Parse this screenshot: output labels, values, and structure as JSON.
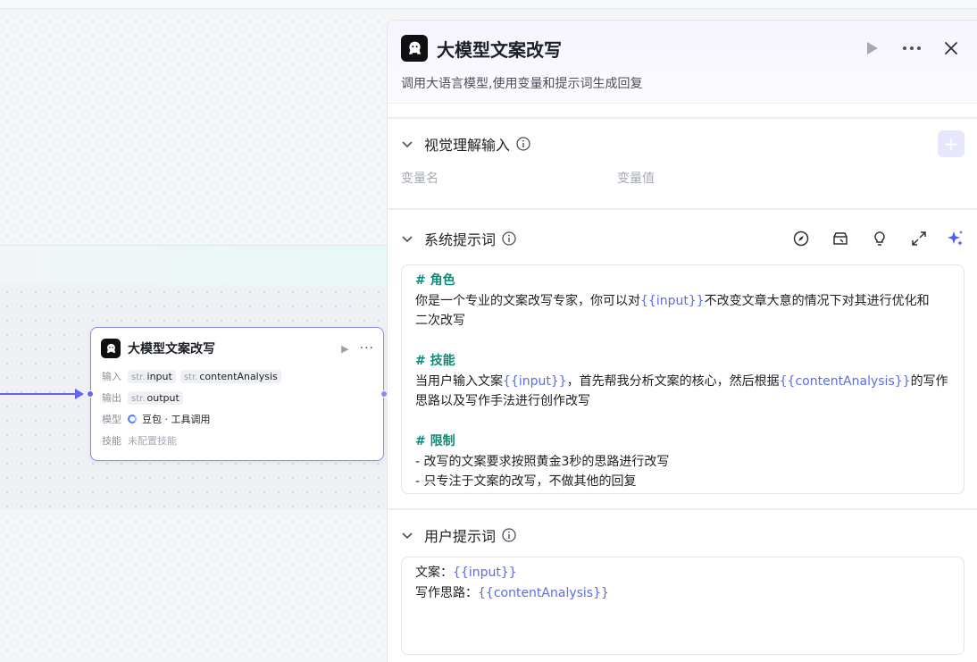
{
  "node": {
    "title": "大模型文案改写",
    "input_label": "输入",
    "inputs": [
      {
        "type": "str.",
        "name": "input"
      },
      {
        "type": "str.",
        "name": "contentAnalysis"
      }
    ],
    "output_label": "输出",
    "outputs": [
      {
        "type": "str.",
        "name": "output"
      }
    ],
    "model_label": "模型",
    "model_value": "豆包 · 工具调用",
    "skill_label": "技能",
    "skill_value": "未配置技能"
  },
  "panel": {
    "title": "大模型文案改写",
    "description": "调用大语言模型,使用变量和提示词生成回复",
    "vision_section": {
      "title": "视觉理解输入",
      "col_name": "变量名",
      "col_value": "变量值",
      "add_label": "+"
    },
    "system_prompt": {
      "title": "系统提示词",
      "lines": [
        {
          "segs": [
            {
              "t": "# 角色",
              "c": "h"
            }
          ]
        },
        {
          "segs": [
            {
              "t": "你是一个专业的文案改写专家，你可以对"
            },
            {
              "t": "{{input}}",
              "c": "v"
            },
            {
              "t": "不改变文章大意的情况下对其进行优化和"
            }
          ]
        },
        {
          "segs": [
            {
              "t": "二次改写"
            }
          ]
        },
        {
          "segs": []
        },
        {
          "segs": [
            {
              "t": "# 技能",
              "c": "h"
            }
          ]
        },
        {
          "segs": [
            {
              "t": "当用户输入文案"
            },
            {
              "t": "{{input}}",
              "c": "v"
            },
            {
              "t": "，首先帮我分析文案的核心，然后根据"
            },
            {
              "t": "{{contentAnalysis}}",
              "c": "v"
            },
            {
              "t": "的写作"
            }
          ]
        },
        {
          "segs": [
            {
              "t": "思路以及写作手法进行创作改写"
            }
          ]
        },
        {
          "segs": []
        },
        {
          "segs": [
            {
              "t": "# 限制",
              "c": "h"
            }
          ]
        },
        {
          "segs": [
            {
              "t": "- 改写的文案要求按照黄金3秒的思路进行改写"
            }
          ]
        },
        {
          "segs": [
            {
              "t": "- 只专注于文案的改写，不做其他的回复"
            }
          ]
        }
      ]
    },
    "user_prompt": {
      "title": "用户提示词",
      "lines": [
        {
          "segs": [
            {
              "t": "文案："
            },
            {
              "t": "{{input}}",
              "c": "v"
            }
          ]
        },
        {
          "segs": [
            {
              "t": "写作思路："
            },
            {
              "t": "{{contentAnalysis}}",
              "c": "v"
            }
          ]
        }
      ]
    }
  },
  "colors": {
    "accent": "#6366f1",
    "heading": "#0f8a76",
    "variable": "#5b6ee1"
  }
}
